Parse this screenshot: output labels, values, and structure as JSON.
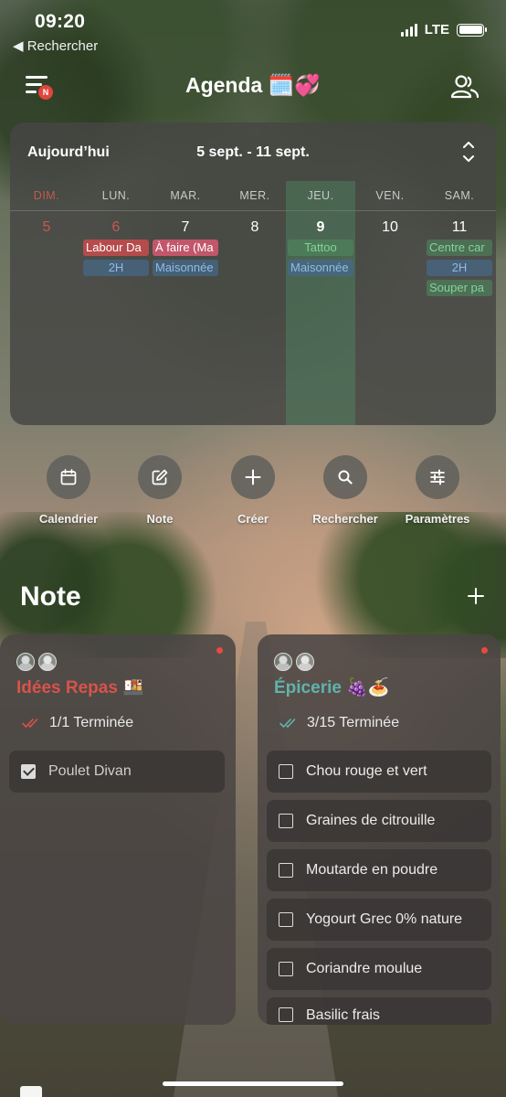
{
  "status_bar": {
    "time": "09:20",
    "back_label": "◀ Rechercher",
    "network": "LTE"
  },
  "header": {
    "title": "Agenda 🗓️💞",
    "menu_badge": "N"
  },
  "calendar": {
    "today_label": "Aujourd’hui",
    "range": "5 sept. - 11 sept.",
    "days": [
      {
        "name": "DIM.",
        "num": "5"
      },
      {
        "name": "LUN.",
        "num": "6"
      },
      {
        "name": "MAR.",
        "num": "7"
      },
      {
        "name": "MER.",
        "num": "8"
      },
      {
        "name": "JEU.",
        "num": "9"
      },
      {
        "name": "VEN.",
        "num": "10"
      },
      {
        "name": "SAM.",
        "num": "11"
      }
    ],
    "events": {
      "mon_1": "Labour Da",
      "mon_2": "2H",
      "tue_1": "À faire (Ma",
      "tue_2": "Maisonnée",
      "thu_1": "Tattoo",
      "thu_2": "Maisonnée",
      "sat_1": "Centre car",
      "sat_2": "2H",
      "sat_3": "Souper pa"
    }
  },
  "actions": [
    {
      "label": "Calendrier",
      "icon": "calendar-icon"
    },
    {
      "label": "Note",
      "icon": "edit-icon"
    },
    {
      "label": "Créer",
      "icon": "plus-icon"
    },
    {
      "label": "Rechercher",
      "icon": "search-icon"
    },
    {
      "label": "Paramètres",
      "icon": "sliders-icon"
    }
  ],
  "notes_section": {
    "title": "Note"
  },
  "notes": [
    {
      "title": "Idées Repas 🍱",
      "progress": "1/1 Terminée",
      "items": [
        {
          "text": "Poulet Divan",
          "checked": true
        }
      ]
    },
    {
      "title": "Épicerie 🍇🍝",
      "progress": "3/15 Terminée",
      "items": [
        {
          "text": "Chou rouge et vert",
          "checked": false
        },
        {
          "text": "Graines de citrouille",
          "checked": false
        },
        {
          "text": "Moutarde en poudre",
          "checked": false
        },
        {
          "text": "Yogourt Grec 0% nature",
          "checked": false
        },
        {
          "text": "Coriandre moulue",
          "checked": false
        },
        {
          "text": "Basilic frais",
          "checked": false
        }
      ]
    }
  ],
  "colors": {
    "accent_red": "#d9534a",
    "accent_teal": "#5fb3ac",
    "today_green": "#83d39a",
    "event_blue": "#8fbbe6"
  }
}
